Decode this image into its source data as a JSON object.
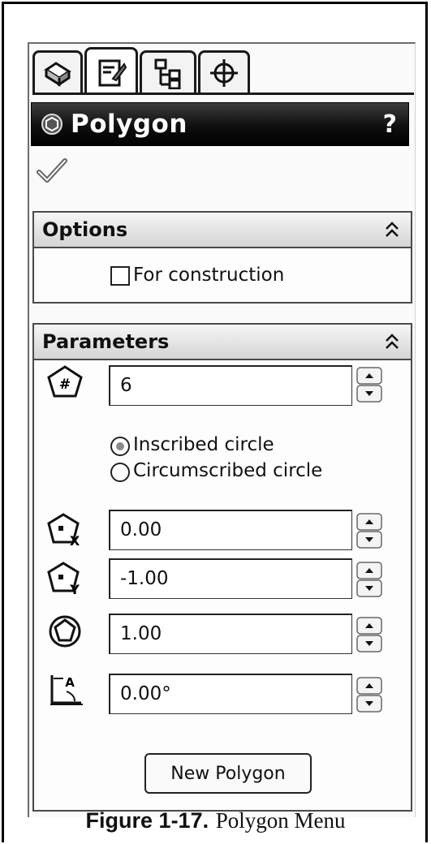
{
  "header": {
    "title": "Polygon",
    "help": "?"
  },
  "tabs": [
    {
      "icon": "feature-manager-icon"
    },
    {
      "icon": "property-manager-icon"
    },
    {
      "icon": "configuration-manager-icon"
    },
    {
      "icon": "dimxpert-manager-icon"
    }
  ],
  "options": {
    "title": "Options",
    "for_construction_label": "For construction",
    "for_construction_checked": false
  },
  "parameters": {
    "title": "Parameters",
    "sides": "6",
    "inscribed_label": "Inscribed circle",
    "circumscribed_label": "Circumscribed circle",
    "selected": "inscribed",
    "center_x": "0.00",
    "center_y": "-1.00",
    "circle_diameter": "1.00",
    "angle": "0.00°"
  },
  "new_polygon_label": "New Polygon",
  "caption": {
    "figure_label": "Figure 1-17.",
    "figure_title": "Polygon Menu"
  }
}
